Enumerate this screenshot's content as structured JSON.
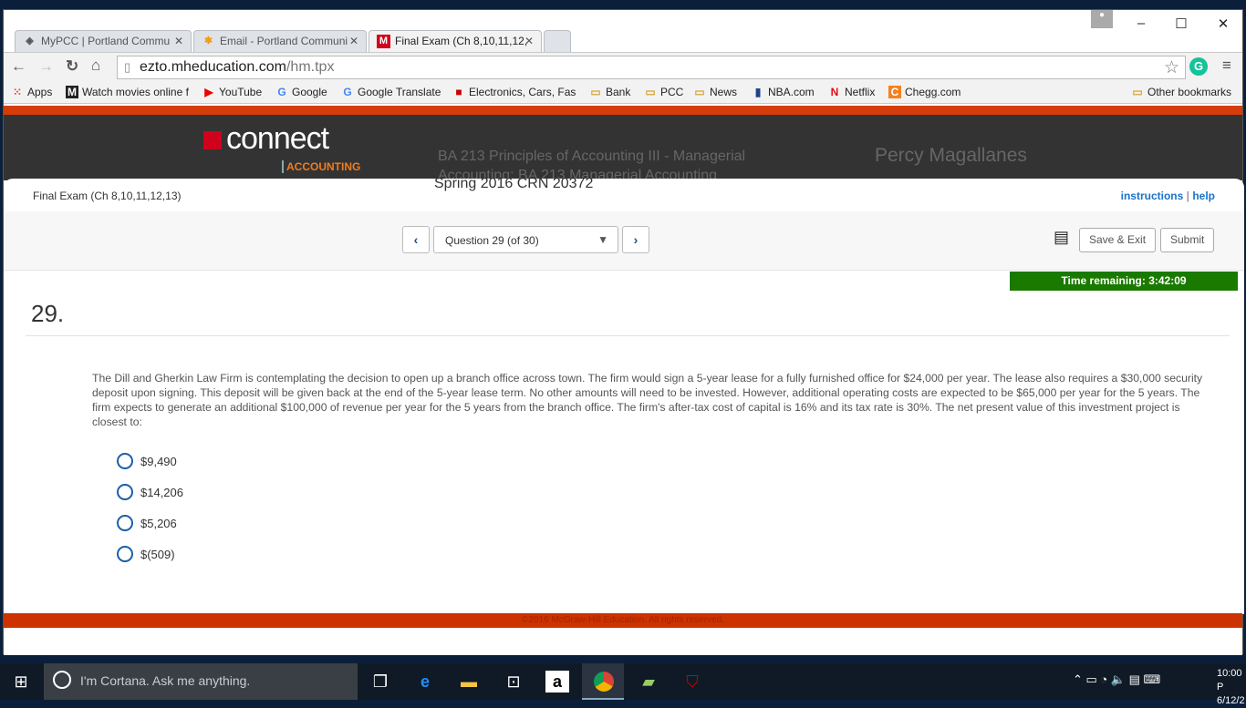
{
  "browser": {
    "tabs": [
      {
        "title": "MyPCC | Portland Commu",
        "icon": "mypcc-icon"
      },
      {
        "title": "Email - Portland Communi",
        "icon": "email-icon"
      },
      {
        "title": "Final Exam (Ch 8,10,11,12,",
        "icon": "mcgraw-m-icon"
      }
    ],
    "url_host": "ezto.mheducation.com",
    "url_path": "/hm.tpx",
    "bookmarks": [
      "Apps",
      "Watch movies online f",
      "YouTube",
      "Google",
      "Google Translate",
      "Electronics, Cars, Fashi",
      "Bank",
      "PCC",
      "News",
      "NBA.com",
      "Netflix",
      "Chegg.com"
    ],
    "other_bookmarks": "Other bookmarks"
  },
  "header": {
    "logo_text": "connect",
    "logo_sub": "ACCOUNTING",
    "logo_badge": "Mc Graw Hill Education",
    "course_line1": "BA 213 Principles of Accounting III - Managerial",
    "course_line2": "Accounting: BA 213 Managerial Accounting",
    "course_line3": "Spring 2016 CRN 20372",
    "user_name": "Percy Magallanes"
  },
  "exam": {
    "title": "Final Exam (Ch 8,10,11,12,13)",
    "instructions": "instructions",
    "sep": "|",
    "help": "help",
    "question_select": "Question 29 (of 30)",
    "save_exit": "Save & Exit",
    "submit": "Submit",
    "time_remaining": "Time remaining: 3:42:09",
    "question_number": "29.",
    "question_text": "The Dill and Gherkin Law Firm is contemplating the decision to open up a branch office across town. The firm would sign a 5-year lease for a fully furnished office for $24,000 per year. The lease also requires a $30,000 security deposit upon signing. This deposit will be given back at the end of the 5-year lease term. No other amounts will need to be invested. However, additional operating costs are expected to be $65,000 per year for the 5 years. The firm expects to generate an additional $100,000 of revenue per year for the 5 years from the branch office. The firm's after-tax cost of capital is 16% and its tax rate is 30%. The net present value of this investment project is closest to:",
    "options": [
      "$9,490",
      "$14,206",
      "$5,206",
      "$(509)"
    ]
  },
  "footer": {
    "copyright": "©2016 McGraw-Hill Education. All rights reserved."
  },
  "taskbar": {
    "cortana": "I'm Cortana. Ask me anything.",
    "time": "10:00 P",
    "date": "6/12/2"
  },
  "colors": {
    "accent_orange": "#cc3300",
    "timer_green": "#1a7a00",
    "link_blue": "#1a73c8",
    "header_dark": "#333333"
  }
}
